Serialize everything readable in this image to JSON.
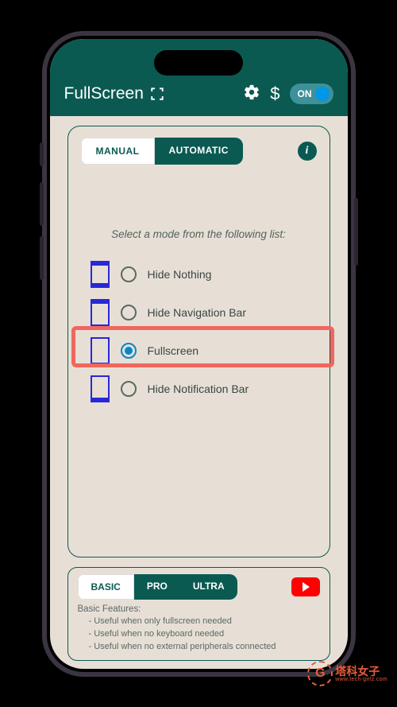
{
  "header": {
    "title": "FullScreen",
    "toggle_label": "ON"
  },
  "tabs": {
    "manual": "MANUAL",
    "automatic": "AUTOMATIC"
  },
  "prompt": "Select a mode from the following list:",
  "modes": {
    "hide_nothing": "Hide Nothing",
    "hide_nav": "Hide Navigation Bar",
    "fullscreen": "Fullscreen",
    "hide_notif": "Hide Notification Bar"
  },
  "bottom_tabs": {
    "basic": "BASIC",
    "pro": "PRO",
    "ultra": "ULTRA"
  },
  "features": {
    "title": "Basic Features:",
    "f1": "- Useful when only fullscreen needed",
    "f2": "- Useful when no keyboard needed",
    "f3": "- Useful when no external peripherals connected"
  },
  "watermark": {
    "glyph": "G",
    "main": "塔科女子",
    "sub": "www.tech-girlz.com"
  }
}
